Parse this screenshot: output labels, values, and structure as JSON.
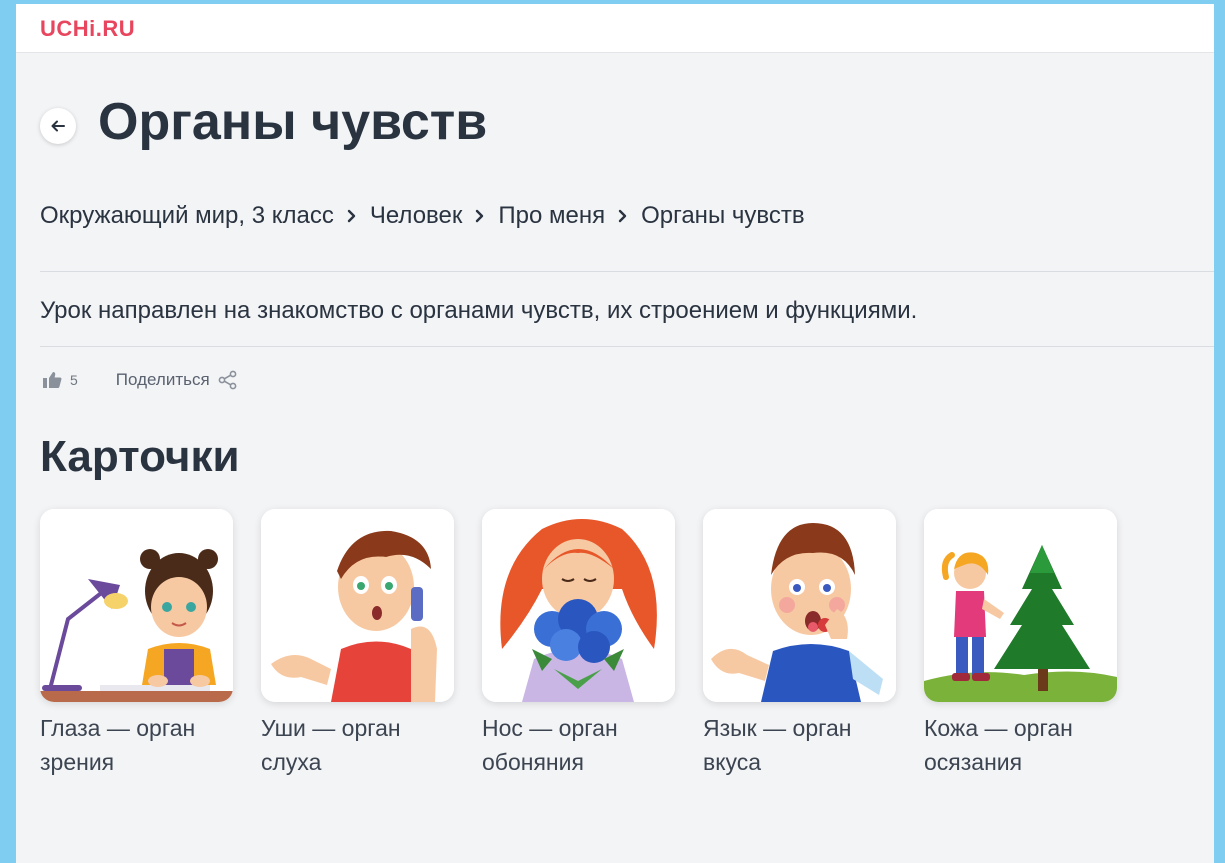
{
  "brand": {
    "logo_text": "UCHi.RU",
    "color": "#e8465e"
  },
  "page": {
    "title": "Органы чувств",
    "description": "Урок направлен на знакомство с органами чувств, их строением и функциями."
  },
  "breadcrumb": [
    "Окружающий мир, 3 класс",
    "Человек",
    "Про меня",
    "Органы чувств"
  ],
  "meta": {
    "likes": "5",
    "share_label": "Поделиться"
  },
  "section": {
    "title": "Карточки"
  },
  "cards": [
    {
      "caption": "Глаза — орган зрения",
      "icon": "girl-with-lamp"
    },
    {
      "caption": "Уши — орган слуха",
      "icon": "boy-on-phone"
    },
    {
      "caption": "Нос — орган обоняния",
      "icon": "girl-smelling-flowers"
    },
    {
      "caption": "Язык — орган вкуса",
      "icon": "boy-tasting"
    },
    {
      "caption": "Кожа — орган осязания",
      "icon": "girl-touching-tree"
    }
  ],
  "colors": {
    "text": "#2a3340",
    "background": "#f3f4f6",
    "frame": "#7fcdf0"
  }
}
